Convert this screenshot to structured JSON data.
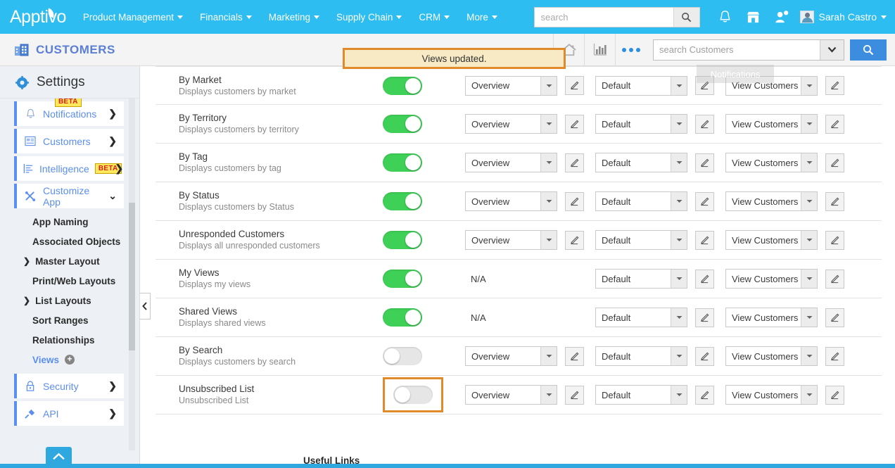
{
  "topnav": {
    "logo": "Apptivo",
    "menus": [
      {
        "label": "Product Management"
      },
      {
        "label": "Financials"
      },
      {
        "label": "Marketing"
      },
      {
        "label": "Supply Chain"
      },
      {
        "label": "CRM"
      },
      {
        "label": "More"
      }
    ],
    "search_placeholder": "search",
    "search_value": "",
    "icons": [
      "bell-icon",
      "store-icon",
      "person-add-icon"
    ],
    "user_name": "Sarah Castro"
  },
  "appheader": {
    "title": "CUSTOMERS",
    "toast_message": "Views updated.",
    "tooltip": "Notifications",
    "customer_search_placeholder": "search Customers",
    "customer_search_value": ""
  },
  "sidebar": {
    "heading": "Settings",
    "cards": [
      {
        "label": "Notifications",
        "icon": "bell-icon",
        "badge": "BETA",
        "chevron": "❯"
      },
      {
        "label": "Customers",
        "icon": "customers-icon",
        "badge": "",
        "chevron": "❯"
      },
      {
        "label": "Intelligence",
        "icon": "intelligence-icon",
        "badge": "BETA",
        "chevron": "❯"
      },
      {
        "label": "Customize App",
        "icon": "tools-icon",
        "badge": "",
        "chevron": "⌄"
      }
    ],
    "sub_items": [
      {
        "label": "App Naming",
        "arrow": "",
        "active": false
      },
      {
        "label": "Associated Objects",
        "arrow": "",
        "active": false
      },
      {
        "label": "Master Layout",
        "arrow": "❯",
        "active": false
      },
      {
        "label": "Print/Web Layouts",
        "arrow": "",
        "active": false
      },
      {
        "label": "List Layouts",
        "arrow": "❯",
        "active": false
      },
      {
        "label": "Sort Ranges",
        "arrow": "",
        "active": false
      },
      {
        "label": "Relationships",
        "arrow": "",
        "active": false
      },
      {
        "label": "Views",
        "arrow": "",
        "active": true,
        "plus": "+"
      }
    ],
    "bottom_cards": [
      {
        "label": "Security",
        "icon": "lock-icon",
        "chevron": "❯"
      },
      {
        "label": "API",
        "icon": "plug-icon",
        "chevron": "❯"
      }
    ]
  },
  "main": {
    "rows": [
      {
        "name": "By Market",
        "desc": "Displays customers by market",
        "enabled": true,
        "layout": "Overview",
        "has_layout": true,
        "scheme": "Default",
        "action": "View Customers",
        "highlight": false
      },
      {
        "name": "By Territory",
        "desc": "Displays customers by territory",
        "enabled": true,
        "layout": "Overview",
        "has_layout": true,
        "scheme": "Default",
        "action": "View Customers",
        "highlight": false
      },
      {
        "name": "By Tag",
        "desc": "Displays customers by tag",
        "enabled": true,
        "layout": "Overview",
        "has_layout": true,
        "scheme": "Default",
        "action": "View Customers",
        "highlight": false
      },
      {
        "name": "By Status",
        "desc": "Displays customers by Status",
        "enabled": true,
        "layout": "Overview",
        "has_layout": true,
        "scheme": "Default",
        "action": "View Customers",
        "highlight": false
      },
      {
        "name": "Unresponded Customers",
        "desc": "Displays all unresponded customers",
        "enabled": true,
        "layout": "Overview",
        "has_layout": true,
        "scheme": "Default",
        "action": "View Customers",
        "highlight": false
      },
      {
        "name": "My Views",
        "desc": "Displays my views",
        "enabled": true,
        "layout": "N/A",
        "has_layout": false,
        "scheme": "Default",
        "action": "View Customers",
        "highlight": false
      },
      {
        "name": "Shared Views",
        "desc": "Displays shared views",
        "enabled": true,
        "layout": "N/A",
        "has_layout": false,
        "scheme": "Default",
        "action": "View Customers",
        "highlight": false
      },
      {
        "name": "By Search",
        "desc": "Displays customers by search",
        "enabled": false,
        "layout": "Overview",
        "has_layout": true,
        "scheme": "Default",
        "action": "View Customers",
        "highlight": false
      },
      {
        "name": "Unsubscribed List",
        "desc": "Unsubscribed List",
        "enabled": false,
        "layout": "Overview",
        "has_layout": true,
        "scheme": "Default",
        "action": "View Customers",
        "highlight": true
      }
    ],
    "footer_heading": "Useful Links"
  },
  "colors": {
    "brand_blue": "#2dbdf0",
    "accent_blue": "#5b8ef0",
    "toggle_on": "#3fd058",
    "toggle_off": "#e6e6e6",
    "highlight_orange": "#e08a2a",
    "toast_bg": "#f7eac4",
    "beta_badge": "#ffe85c"
  }
}
